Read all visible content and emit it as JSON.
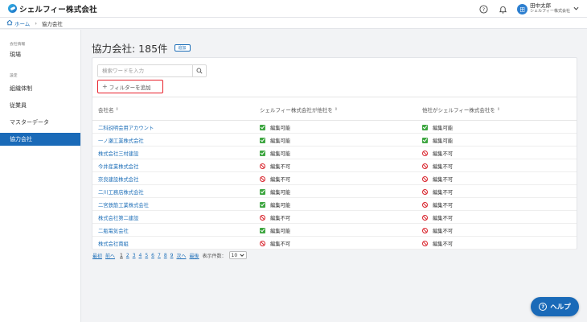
{
  "header": {
    "brand": "シェルフィー株式会社",
    "help_icon": "question-circle-icon",
    "bell_icon": "bell-icon",
    "user": {
      "avatar_label": "田",
      "name": "田中太郎",
      "company": "シェルフィー株式会社"
    }
  },
  "breadcrumb": {
    "home": "ホーム",
    "separator": "›",
    "current": "協力会社"
  },
  "sidebar": {
    "section1": "会社情報",
    "site": "現場",
    "section2": "設定",
    "items": [
      "組織体制",
      "従業員",
      "マスターデータ",
      "協力会社"
    ],
    "active_index": 3
  },
  "main": {
    "title": "協力会社: 185件",
    "add_label": "追加",
    "search_placeholder": "検索ワードを入力",
    "filter_label": "フィルターを追加",
    "columns": [
      "会社名",
      "シェルフィー株式会社が他社を",
      "他社がシェルフィー株式会社を"
    ],
    "rows": [
      {
        "name": "二科説明会用アカウント",
        "a": "編集可能",
        "a_ok": true,
        "b": "編集可能",
        "b_ok": true
      },
      {
        "name": "一ノ瀬工業株式会社",
        "a": "編集可能",
        "a_ok": true,
        "b": "編集可能",
        "b_ok": true
      },
      {
        "name": "株式会社三村建設",
        "a": "編集可能",
        "a_ok": true,
        "b": "編集不可",
        "b_ok": false
      },
      {
        "name": "今井産業株式会社",
        "a": "編集不可",
        "a_ok": false,
        "b": "編集不可",
        "b_ok": false
      },
      {
        "name": "奈良建設株式会社",
        "a": "編集不可",
        "a_ok": false,
        "b": "編集不可",
        "b_ok": false
      },
      {
        "name": "二川工務店株式会社",
        "a": "編集可能",
        "a_ok": true,
        "b": "編集不可",
        "b_ok": false
      },
      {
        "name": "二宮鉄筋工業株式会社",
        "a": "編集可能",
        "a_ok": true,
        "b": "編集不可",
        "b_ok": false
      },
      {
        "name": "株式会社第二建設",
        "a": "編集不可",
        "a_ok": false,
        "b": "編集不可",
        "b_ok": false
      },
      {
        "name": "二瓶電気会社",
        "a": "編集可能",
        "a_ok": true,
        "b": "編集不可",
        "b_ok": false
      },
      {
        "name": "株式会社南組",
        "a": "編集不可",
        "a_ok": false,
        "b": "編集不可",
        "b_ok": false
      }
    ]
  },
  "pagination": {
    "first": "最初",
    "prev": "前へ",
    "pages": [
      "1",
      "2",
      "3",
      "4",
      "5",
      "6",
      "7",
      "8",
      "9"
    ],
    "current_page": "1",
    "next": "次へ",
    "last": "最後",
    "per_page_label": "表示件数：",
    "per_page_value": "10"
  },
  "help_button": {
    "label": "ヘルプ"
  },
  "colors": {
    "brand": "#1a6ab8",
    "link": "#1e6fb8",
    "ok": "#3da640",
    "ng": "#d9262e",
    "highlight": "#e8202a"
  }
}
